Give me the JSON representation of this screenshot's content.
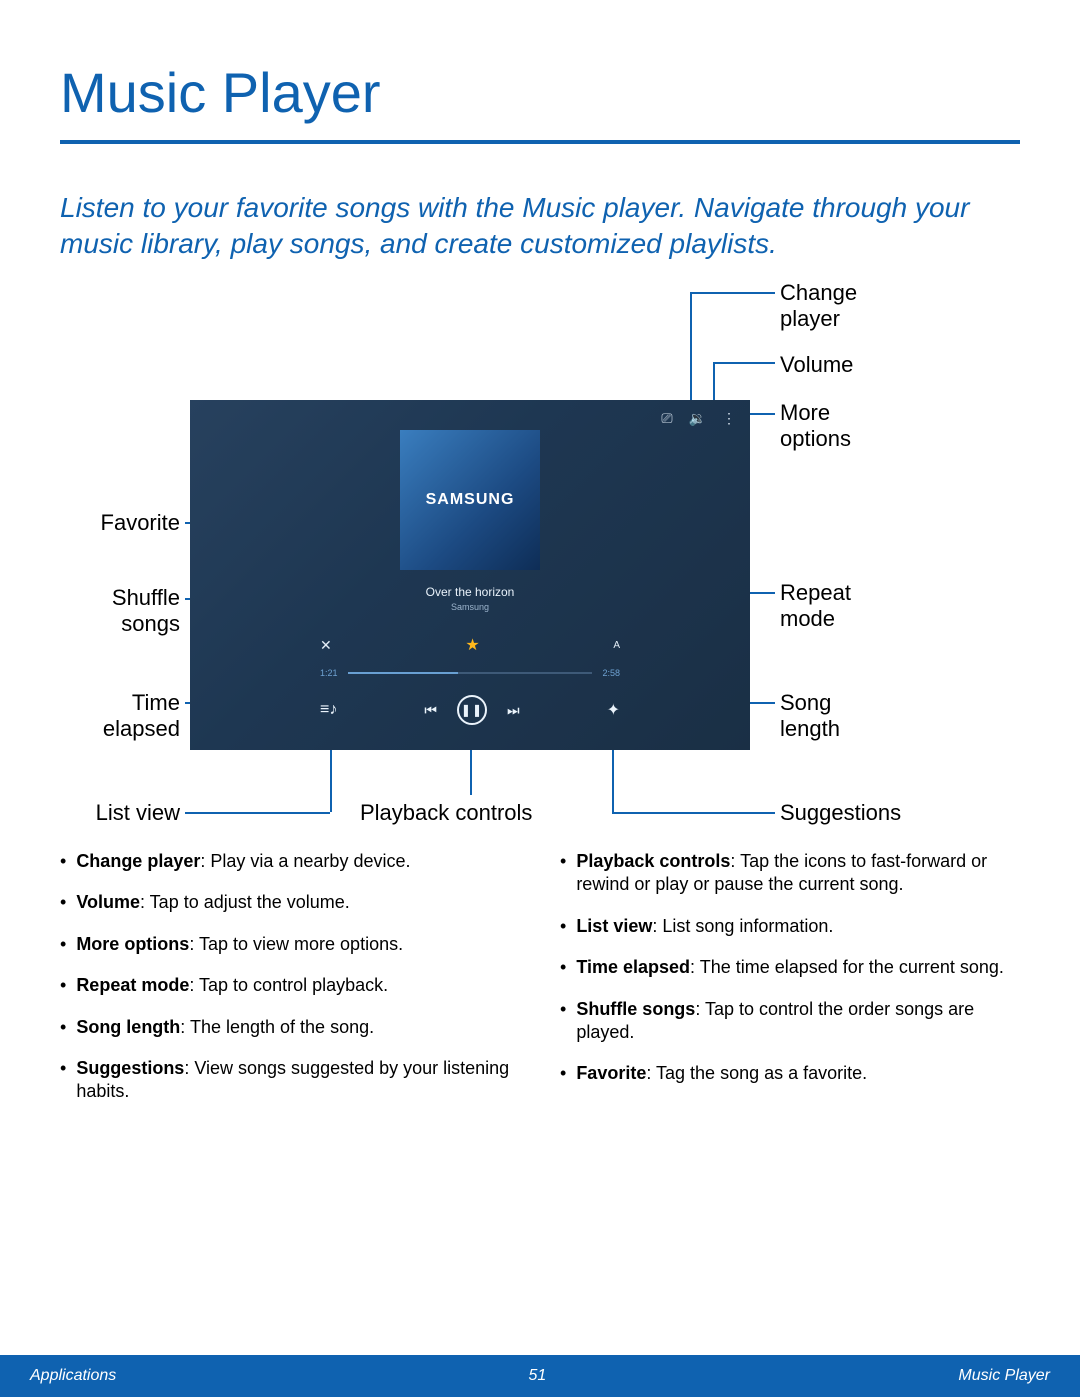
{
  "page": {
    "title": "Music Player",
    "intro": "Listen to your favorite songs with the Music player. Navigate through your music library, play songs, and create customized playlists."
  },
  "callouts": {
    "change_player": "Change player",
    "volume": "Volume",
    "more_options": "More options",
    "favorite": "Favorite",
    "shuffle": "Shuffle songs",
    "time_elapsed": "Time elapsed",
    "list_view": "List view",
    "repeat_mode": "Repeat mode",
    "song_length": "Song length",
    "suggestions": "Suggestions",
    "playback_controls": "Playback controls"
  },
  "player": {
    "brand": "SAMSUNG",
    "song_title": "Over the horizon",
    "song_artist": "Samsung",
    "time_elapsed": "1:21",
    "song_length": "2:58"
  },
  "bullets_left": [
    {
      "term": "Change player",
      "desc": ": Play via a nearby device."
    },
    {
      "term": "Volume",
      "desc": ": Tap to adjust the volume."
    },
    {
      "term": "More options",
      "desc": ": Tap to view more options."
    },
    {
      "term": "Repeat mode",
      "desc": ": Tap to control playback."
    },
    {
      "term": "Song length",
      "desc": ": The length of the song."
    },
    {
      "term": "Suggestions",
      "desc": ": View songs suggested by your listening habits."
    }
  ],
  "bullets_right": [
    {
      "term": "Playback controls",
      "desc": ": Tap the icons to fast-forward or rewind or play or pause the current song."
    },
    {
      "term": "List view",
      "desc": ": List song information."
    },
    {
      "term": "Time elapsed",
      "desc": ": The time elapsed for the current song."
    },
    {
      "term": "Shuffle songs",
      "desc": ": Tap to control the order songs are played."
    },
    {
      "term": "Favorite",
      "desc": ": Tag the song as a favorite."
    }
  ],
  "footer": {
    "left": "Applications",
    "center": "51",
    "right": "Music Player"
  }
}
